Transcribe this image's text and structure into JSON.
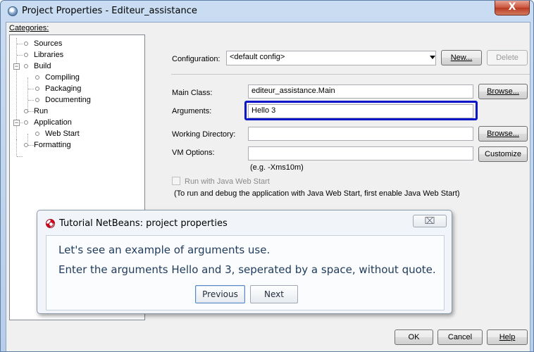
{
  "window": {
    "title": "Project Properties - Editeur_assistance",
    "close_glyph": "X"
  },
  "categories": {
    "label": "Categories:",
    "items": [
      {
        "label": "Sources"
      },
      {
        "label": "Libraries"
      },
      {
        "label": "Build",
        "expanded": true
      },
      {
        "label": "Compiling"
      },
      {
        "label": "Packaging"
      },
      {
        "label": "Documenting"
      },
      {
        "label": "Run",
        "selected": true
      },
      {
        "label": "Application",
        "expanded": true
      },
      {
        "label": "Web Start"
      },
      {
        "label": "Formatting"
      }
    ],
    "expander_glyph": "−"
  },
  "config": {
    "label": "Configuration:",
    "value": "<default config>",
    "new_label": "New...",
    "delete_label": "Delete"
  },
  "form": {
    "main_class_label": "Main Class:",
    "main_class_value": "editeur_assistance.Main",
    "browse_label": "Browse...",
    "arguments_label": "Arguments:",
    "arguments_value": "Hello 3",
    "working_dir_label": "Working Directory:",
    "working_dir_value": "",
    "browse2_label": "Browse...",
    "vm_options_label": "VM Options:",
    "vm_options_value": "",
    "customize_label": "Customize",
    "vm_hint": "(e.g. -Xms10m)",
    "web_start_checkbox_label": "Run with Java Web Start",
    "web_start_checked": false,
    "web_start_note": "(To run and debug the application with Java Web Start, first enable Java Web Start)"
  },
  "tutorial": {
    "title": "Tutorial NetBeans: project properties",
    "close_glyph": "⌧",
    "line1": "Let's see an example of arguments use.",
    "line2": "Enter the arguments Hello and 3, seperated by a space, without quote.",
    "previous_label": "Previous",
    "next_label": "Next"
  },
  "footer": {
    "ok_label": "OK",
    "cancel_label": "Cancel",
    "help_label": "Help"
  },
  "colors": {
    "highlight": "#0a14c8",
    "title_bar": "#c9dcf2",
    "close_button": "#c9523b"
  }
}
